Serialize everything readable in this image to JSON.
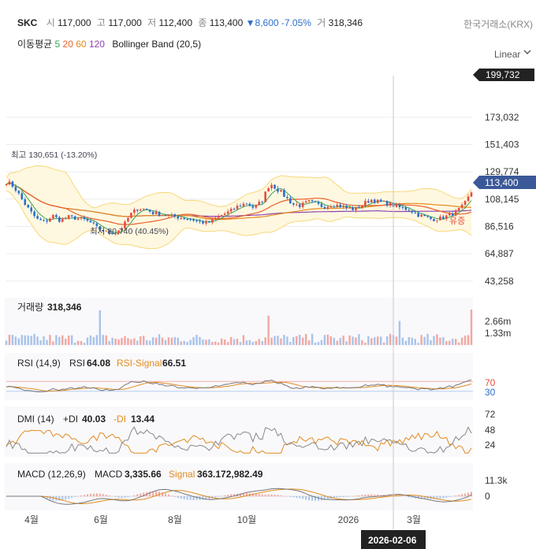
{
  "header": {
    "symbol": "SKC",
    "open_label": "시",
    "open": "117,000",
    "high_label": "고",
    "high": "117,000",
    "low_label": "저",
    "low": "112,400",
    "close_label": "종",
    "close": "113,400",
    "change": "8,600",
    "change_pct": "-7.05%",
    "volume_label": "거",
    "volume": "318,346",
    "exchange": "한국거래소(KRX)"
  },
  "indicators": {
    "ma_label": "이동평균",
    "ma_periods": [
      "5",
      "20",
      "60",
      "120"
    ],
    "bollinger": "Bollinger Band (20,5)"
  },
  "scale_mode": "Linear",
  "colors": {
    "ma5": "#3aa35b",
    "ma20": "#e8612c",
    "ma60": "#e38b1e",
    "ma120": "#8e44ad",
    "up": "#e74c3c",
    "down": "#2c6ecb",
    "band": "#fbe7a9",
    "band_fill": "#fff8e0",
    "price_tag": "#3b5998",
    "high_tag": "#222222"
  },
  "chart_data": [
    {
      "type": "candlestick",
      "x_ticks": [
        "4월",
        "6월",
        "8월",
        "10월",
        "2026",
        "3월"
      ],
      "y_ticks": [
        43258,
        64887,
        86516,
        108145,
        129774,
        151403,
        173032
      ],
      "ylim": [
        35000,
        206000
      ],
      "scale": "linear",
      "grid": true,
      "annotations": {
        "period_high": "최고 130,651 (-13.20%)",
        "period_low": "최저 80,740 (40.45%)",
        "high_tag": "199,732",
        "last_price_tag": "113,400",
        "event_marker": "유증",
        "cursor_date": "2026-02-06"
      },
      "close_path": [
        122000,
        118000,
        108000,
        99000,
        92000,
        90000,
        95000,
        91000,
        94000,
        93000,
        92000,
        89000,
        84000,
        82000,
        81000,
        86000,
        96000,
        101000,
        100000,
        97000,
        96000,
        95000,
        94000,
        93000,
        92000,
        90000,
        89000,
        93000,
        96000,
        99000,
        103000,
        105000,
        101000,
        107000,
        121000,
        116000,
        110000,
        104000,
        103000,
        106000,
        104000,
        102000,
        104000,
        103000,
        101000,
        100000,
        104000,
        108000,
        106000,
        105000,
        103000,
        101000,
        100000,
        96000,
        94000,
        92000,
        93000,
        95000,
        98000,
        103000,
        113400
      ]
    },
    {
      "type": "bar",
      "title": "거래량",
      "value": "318,346",
      "y_ticks": [
        "2.66m",
        "1.33m"
      ],
      "ylim": [
        0,
        3300000
      ],
      "peaks": [
        2600000,
        2650000,
        1800000,
        2200000
      ]
    },
    {
      "type": "line",
      "title": "RSI (14,9)",
      "series": [
        {
          "name": "RSI",
          "value": "64.08"
        },
        {
          "name": "RSI-Signal",
          "value": "66.51"
        }
      ],
      "levels": [
        70,
        30
      ],
      "ylim": [
        0,
        100
      ]
    },
    {
      "type": "line",
      "title": "DMI (14)",
      "series": [
        {
          "name": "+DI",
          "value": "40.03"
        },
        {
          "name": "-DI",
          "value": "13.44"
        }
      ],
      "y_ticks": [
        72,
        48,
        24
      ],
      "ylim": [
        0,
        80
      ]
    },
    {
      "type": "line",
      "title": "MACD (12,26,9)",
      "series": [
        {
          "name": "MACD",
          "value": "3,335.66"
        },
        {
          "name": "Signal",
          "value": "363.172,982.49"
        }
      ],
      "y_ticks": [
        "11.3k",
        "0"
      ]
    }
  ]
}
